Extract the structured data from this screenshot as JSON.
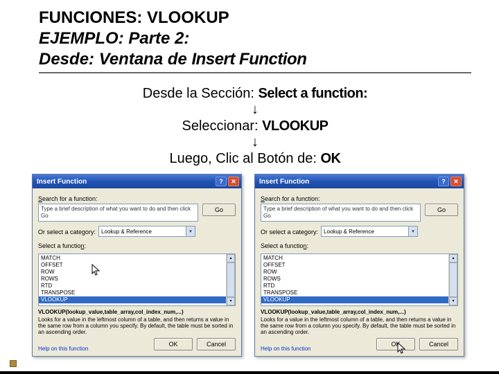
{
  "header": {
    "line1": "FUNCIONES: VLOOKUP",
    "line2": "EJEMPLO: Parte 2:",
    "line3_prefix": "Desde: Ventana de ",
    "line3_emph": "Insert Function"
  },
  "steps": {
    "step1_prefix": "Desde la Sección: ",
    "step1_bold": "Select a function:",
    "step2_prefix": "Seleccionar: ",
    "step2_bold": "VLOOKUP",
    "step3_prefix": "Luego, Clic al Botón de: ",
    "step3_bold": "OK",
    "arrow": "↓"
  },
  "dialog": {
    "title": "Insert Function",
    "search_label_pre": "S",
    "search_label_post": "earch for a function:",
    "search_text": "Type a brief description of what you want to do and then click Go",
    "go_btn": "Go",
    "category_label": "Or select a category:",
    "category_value": "Lookup & Reference",
    "select_label_pre": "Select a functio",
    "select_label_u": "n",
    "select_label_post": ":",
    "functions": [
      "MATCH",
      "OFFSET",
      "ROW",
      "ROWS",
      "RTD",
      "TRANSPOSE",
      "VLOOKUP"
    ],
    "signature": "VLOOKUP(lookup_value,table_array,col_index_num,...)",
    "description": "Looks for a value in the leftmost column of a table, and then returns a value in the same row from a column you specify. By default, the table must be sorted in an ascending order.",
    "help_link": "Help on this function",
    "ok_btn": "OK",
    "cancel_btn": "Cancel",
    "help_icon": "?",
    "close_icon": "✕",
    "dropdown_arrow": "▾",
    "scroll_up": "▴",
    "scroll_down": "▾"
  }
}
